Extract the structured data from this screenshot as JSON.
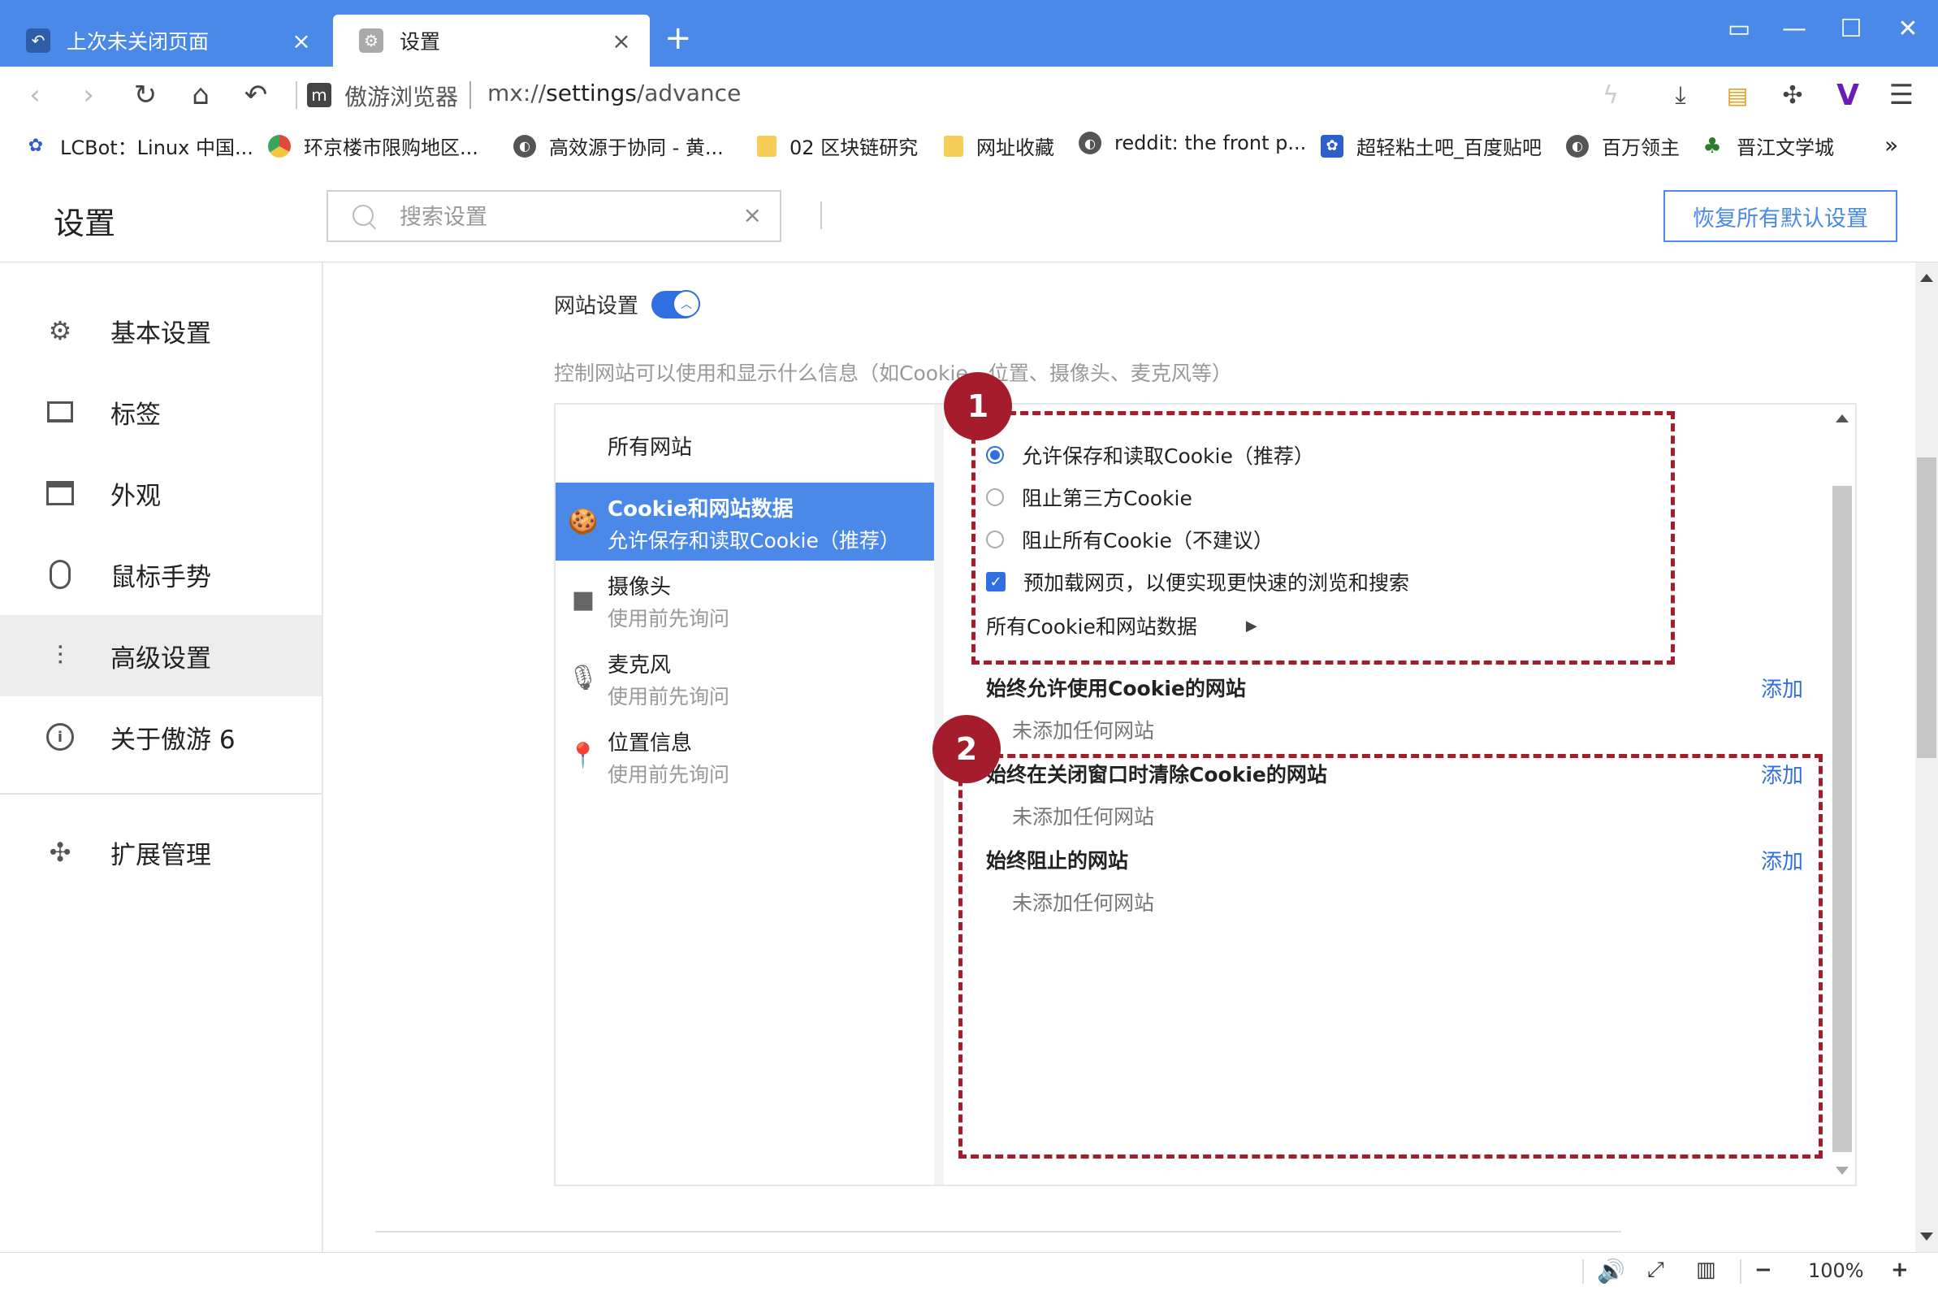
{
  "tabs": [
    {
      "label": "上次未关闭页面",
      "icon": "restore-icon"
    },
    {
      "label": "设置",
      "icon": "settings-gear-icon"
    }
  ],
  "address": {
    "site_name": "傲游浏览器",
    "url_scheme": "mx://",
    "url_host": "settings",
    "url_path": "/advance"
  },
  "bookmarks": [
    {
      "label": "LCBot：Linux 中国...",
      "icon": "baidu-paw-icon"
    },
    {
      "label": "环京楼市限购地区...",
      "icon": "chrome-icon"
    },
    {
      "label": "高效源于协同 - 黄...",
      "icon": "globe-icon"
    },
    {
      "label": "02 区块链研究",
      "icon": "folder-icon"
    },
    {
      "label": "网址收藏",
      "icon": "folder-icon"
    },
    {
      "label": "reddit: the front p...",
      "icon": "globe-icon"
    },
    {
      "label": "超轻粘土吧_百度贴吧",
      "icon": "baidu-paw-icon"
    },
    {
      "label": "百万领主",
      "icon": "globe-icon"
    },
    {
      "label": "晋江文学城",
      "icon": "tree-icon"
    }
  ],
  "bookmarks_more": "»",
  "header": {
    "title": "设置",
    "search_placeholder": "搜索设置",
    "reset_label": "恢复所有默认设置"
  },
  "sidebar": [
    {
      "label": "基本设置",
      "icon": "gear-icon"
    },
    {
      "label": "标签",
      "icon": "tab-icon"
    },
    {
      "label": "外观",
      "icon": "window-icon"
    },
    {
      "label": "鼠标手势",
      "icon": "mouse-icon"
    },
    {
      "label": "高级设置",
      "icon": "sliders-icon",
      "active": true
    },
    {
      "label": "关于傲游 6",
      "icon": "info-icon"
    },
    {
      "label": "扩展管理",
      "icon": "puzzle-icon"
    }
  ],
  "site_settings": {
    "label": "网站设置",
    "enabled": true,
    "description": "控制网站可以使用和显示什么信息（如Cookie、位置、摄像头、麦克风等）"
  },
  "categories": [
    {
      "title": "所有网站",
      "sub": ""
    },
    {
      "title": "Cookie和网站数据",
      "sub": "允许保存和读取Cookie（推荐）",
      "active": true
    },
    {
      "title": "摄像头",
      "sub": "使用前先询问"
    },
    {
      "title": "麦克风",
      "sub": "使用前先询问"
    },
    {
      "title": "位置信息",
      "sub": "使用前先询问"
    }
  ],
  "cookie_options": [
    {
      "label": "允许保存和读取Cookie（推荐）",
      "checked": true
    },
    {
      "label": "阻止第三方Cookie",
      "checked": false
    },
    {
      "label": "阻止所有Cookie（不建议）",
      "checked": false
    }
  ],
  "preload_option": {
    "label": "预加载网页，以便实现更快速的浏览和搜索",
    "checked": true
  },
  "all_cookie_link": "所有Cookie和网站数据",
  "sections": [
    {
      "title": "始终允许使用Cookie的网站",
      "add": "添加",
      "empty": "未添加任何网站"
    },
    {
      "title": "始终在关闭窗口时清除Cookie的网站",
      "add": "添加",
      "empty": "未添加任何网站"
    },
    {
      "title": "始终阻止的网站",
      "add": "添加",
      "empty": "未添加任何网站"
    }
  ],
  "annotations": [
    {
      "label": "1"
    },
    {
      "label": "2"
    }
  ],
  "status": {
    "zoom": "100%",
    "zoom_out": "−",
    "zoom_in": "+"
  },
  "colors": {
    "accent": "#4a89e8",
    "annotation": "#a51d2d"
  }
}
